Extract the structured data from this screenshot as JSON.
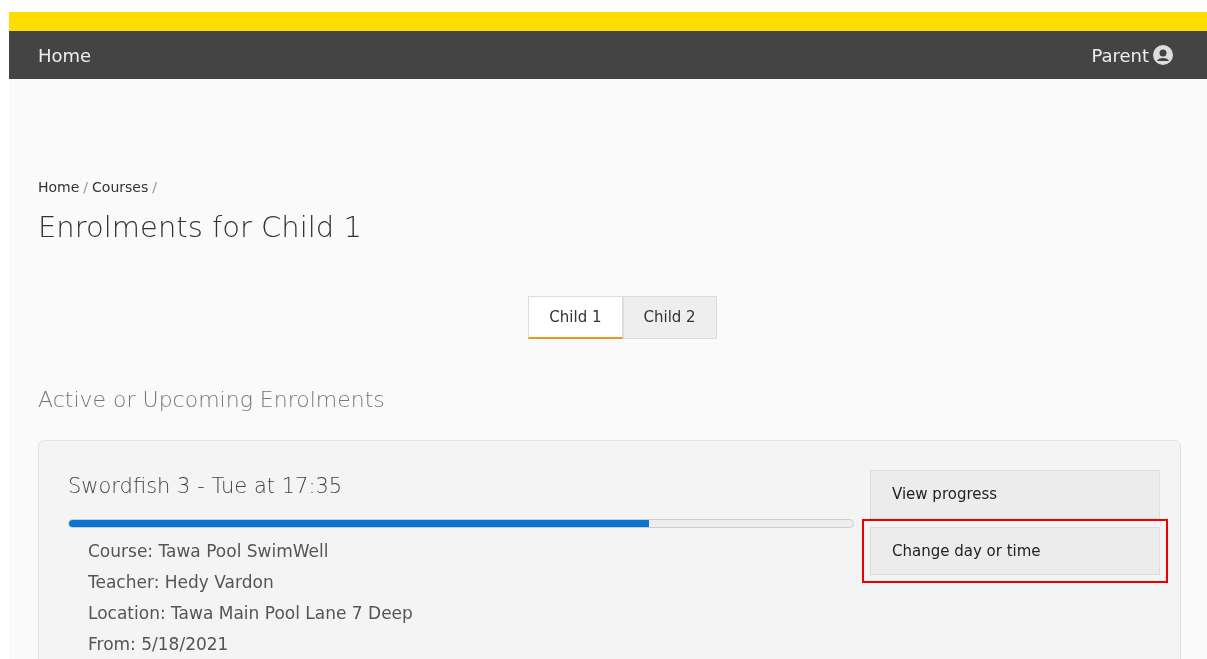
{
  "navbar": {
    "brand": "Home",
    "user": "Parent"
  },
  "breadcrumb": [
    {
      "label": "Home",
      "separator": "/"
    },
    {
      "label": "Courses",
      "separator": "/"
    }
  ],
  "title": "Enrolments for Child 1",
  "tabs": [
    {
      "label": "Child 1",
      "selected": true
    },
    {
      "label": "Child 2",
      "selected": false
    }
  ],
  "section_title": "Active or Upcoming Enrolments",
  "enrolments": [
    {
      "title": "Swordfish 3 - Tue at 17:35",
      "level": 0.74,
      "details": [
        "Course: Tawa Pool SwimWell",
        "Teacher: Hedy Vardon",
        "Location: Tawa Main Pool Lane 7 Deep",
        "From: 5/18/2021"
      ],
      "buttons": [
        {
          "label": "View progress",
          "highlighted": false
        },
        {
          "label": "Change day or time",
          "highlighted": true
        }
      ]
    }
  ]
}
